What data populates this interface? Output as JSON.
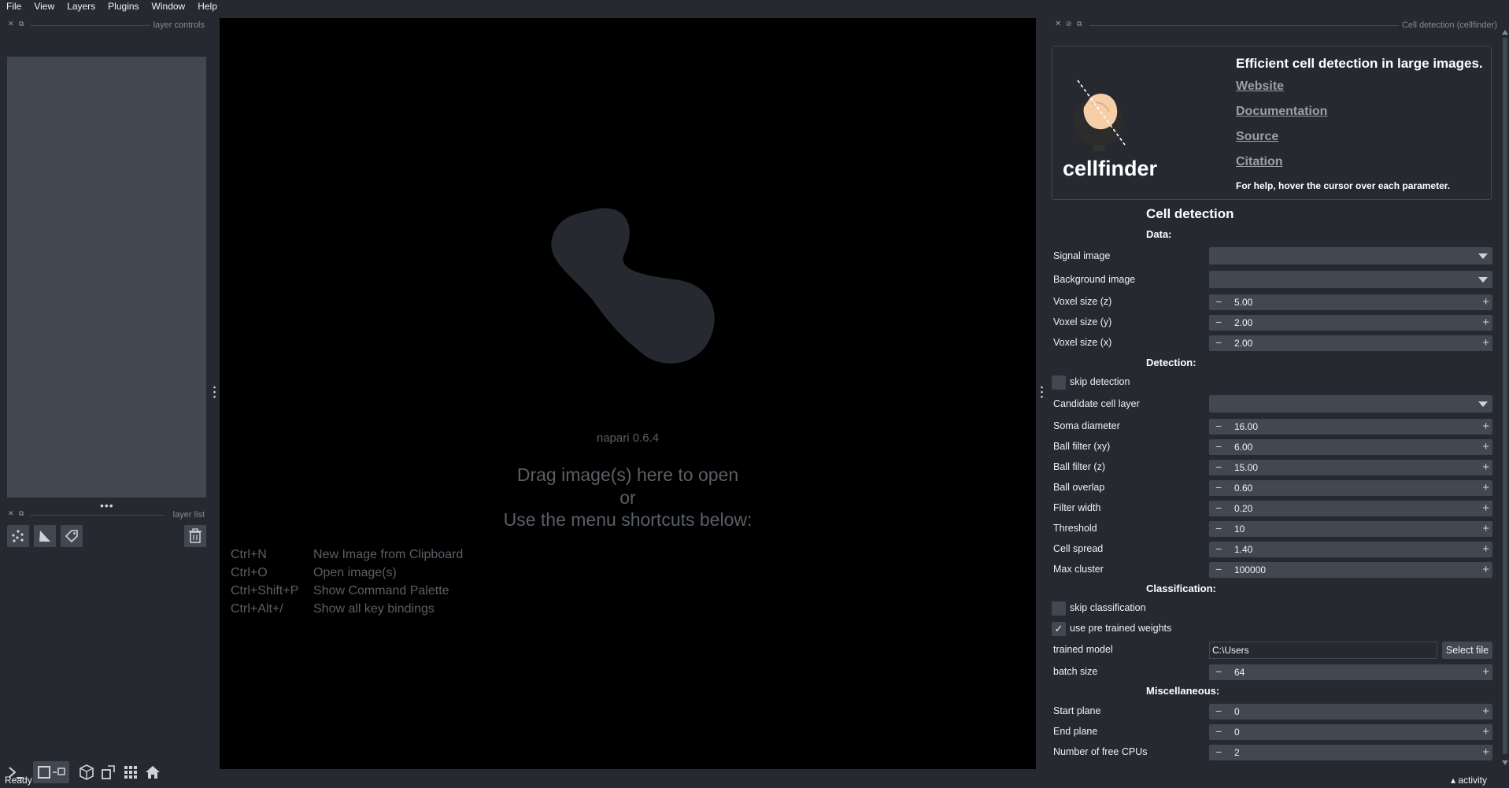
{
  "menu": [
    "File",
    "View",
    "Layers",
    "Plugins",
    "Window",
    "Help"
  ],
  "left": {
    "layer_controls_title": "layer controls",
    "layer_list_title": "layer list"
  },
  "canvas": {
    "version": "napari 0.6.4",
    "line1": "Drag image(s) here to open",
    "line2": "or",
    "line3": "Use the menu shortcuts below:",
    "shortcuts": [
      {
        "key": "Ctrl+N",
        "action": "New Image from Clipboard"
      },
      {
        "key": "Ctrl+O",
        "action": "Open image(s)"
      },
      {
        "key": "Ctrl+Shift+P",
        "action": "Show Command Palette"
      },
      {
        "key": "Ctrl+Alt+/",
        "action": "Show all key bindings"
      }
    ]
  },
  "panel": {
    "title": "Cell detection (cellfinder)",
    "app_name": "cellfinder",
    "tagline": "Efficient cell detection in large images.",
    "links": [
      "Website",
      "Documentation",
      "Source",
      "Citation"
    ],
    "help_note": "For help, hover the cursor over each parameter.",
    "section_title": "Cell detection",
    "data_title": "Data:",
    "signal_label": "Signal image",
    "background_label": "Background image",
    "voxel_z_label": "Voxel size (z)",
    "voxel_z": "5.00",
    "voxel_y_label": "Voxel size (y)",
    "voxel_y": "2.00",
    "voxel_x_label": "Voxel size (x)",
    "voxel_x": "2.00",
    "detection_title": "Detection:",
    "skip_detection_label": "skip detection",
    "candidate_label": "Candidate cell layer",
    "soma_label": "Soma diameter",
    "soma": "16.00",
    "ball_xy_label": "Ball filter (xy)",
    "ball_xy": "6.00",
    "ball_z_label": "Ball filter (z)",
    "ball_z": "15.00",
    "ball_overlap_label": "Ball overlap",
    "ball_overlap": "0.60",
    "filter_width_label": "Filter width",
    "filter_width": "0.20",
    "threshold_label": "Threshold",
    "threshold": "10",
    "cell_spread_label": "Cell spread",
    "cell_spread": "1.40",
    "max_cluster_label": "Max cluster",
    "max_cluster": "100000",
    "classification_title": "Classification:",
    "skip_classification_label": "skip classification",
    "pretrained_label": "use pre trained weights",
    "trained_model_label": "trained model",
    "trained_model": "C:\\Users",
    "select_file": "Select file",
    "batch_label": "batch size",
    "batch": "64",
    "misc_title": "Miscellaneous:",
    "start_plane_label": "Start plane",
    "start_plane": "0",
    "end_plane_label": "End plane",
    "end_plane": "0",
    "cpus_label": "Number of free CPUs",
    "cpus": "2"
  },
  "status": {
    "text": "Ready",
    "activity": "activity"
  }
}
